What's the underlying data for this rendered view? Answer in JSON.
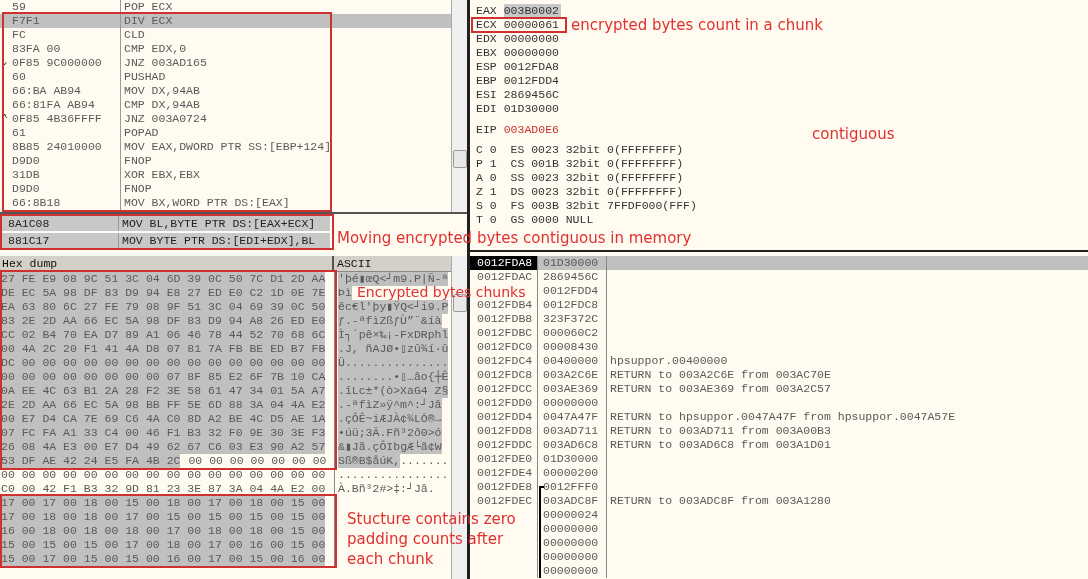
{
  "disassembly": {
    "rows": [
      {
        "hex": "59",
        "command": "POP ECX",
        "selected": false
      },
      {
        "hex": "F7F1",
        "command": "DIV ECX",
        "selected": true
      },
      {
        "hex": "FC",
        "command": "CLD",
        "selected": false
      },
      {
        "hex": "83FA 00",
        "command": "CMP EDX,0",
        "selected": false
      },
      {
        "hex": "0F85 9C000000",
        "command": "JNZ 003AD165",
        "selected": false,
        "marker": "⌄"
      },
      {
        "hex": "60",
        "command": "PUSHAD",
        "selected": false
      },
      {
        "hex": "66:BA AB94",
        "command": "MOV DX,94AB",
        "selected": false
      },
      {
        "hex": "66:81FA AB94",
        "command": "CMP DX,94AB",
        "selected": false
      },
      {
        "hex": "0F85 4B36FFFF",
        "command": "JNZ 003A0724",
        "selected": false,
        "marker": "^"
      },
      {
        "hex": "61",
        "command": "POPAD",
        "selected": false
      },
      {
        "hex": "8B85 24010000",
        "command": "MOV EAX,DWORD PTR SS:[EBP+124]",
        "selected": false
      },
      {
        "hex": "D9D0",
        "command": "FNOP",
        "selected": false
      },
      {
        "hex": "31DB",
        "command": "XOR EBX,EBX",
        "selected": false
      },
      {
        "hex": "D9D0",
        "command": "FNOP",
        "selected": false
      },
      {
        "hex": "66:8B18",
        "command": "MOV BX,WORD PTR DS:[EAX]",
        "selected": false
      }
    ],
    "pinned_rows": [
      {
        "hex": "8A1C08",
        "command": "MOV BL,BYTE PTR DS:[EAX+ECX]"
      },
      {
        "hex": "881C17",
        "command": "MOV BYTE PTR DS:[EDI+EDX],BL"
      }
    ]
  },
  "registers": {
    "rows": [
      {
        "name": "EAX",
        "value": "003B0002",
        "selected": true,
        "changed": false
      },
      {
        "name": "ECX",
        "value": "00000061",
        "selected": false,
        "changed": false
      },
      {
        "name": "EDX",
        "value": "00000000",
        "selected": false,
        "changed": false
      },
      {
        "name": "EBX",
        "value": "00000000",
        "selected": false,
        "changed": false
      },
      {
        "name": "ESP",
        "value": "0012FDA8",
        "selected": false,
        "changed": false
      },
      {
        "name": "EBP",
        "value": "0012FDD4",
        "selected": false,
        "changed": false
      },
      {
        "name": "ESI",
        "value": "2869456C",
        "selected": false,
        "changed": false
      },
      {
        "name": "EDI",
        "value": "01D30000",
        "selected": false,
        "changed": false
      }
    ],
    "eip": {
      "name": "EIP",
      "value": "003AD0E6",
      "selected": false,
      "changed": true
    },
    "flags": [
      "C 0  ES 0023 32bit 0(FFFFFFFF)",
      "P 1  CS 001B 32bit 0(FFFFFFFF)",
      "A 0  SS 0023 32bit 0(FFFFFFFF)",
      "Z 1  DS 0023 32bit 0(FFFFFFFF)",
      "S 0  FS 003B 32bit 7FFDF000(FFF)",
      "T 0  GS 0000 NULL"
    ]
  },
  "hex_dump": {
    "columns": [
      "Hex dump",
      "ASCII"
    ],
    "rows": [
      {
        "hex": [
          {
            "text": "27 FE E9 08 9C 51 3C 04 6D 39 0C 50 7C D1 2D AA",
            "selected": true
          }
        ],
        "ascii": [
          {
            "text": "'þé▮œQ<┘m9.P|Ñ-ª",
            "selected": true
          }
        ]
      },
      {
        "hex": [
          {
            "text": "DE EC 5A 98 DF 83 D9 94 E8 27 ED E0 C2 1D 0E 7E",
            "selected": true
          }
        ],
        "ascii": [
          {
            "text": "Þì",
            "selected": true
          }
        ]
      },
      {
        "hex": [
          {
            "text": "EA 63 80 6C 27 FE 79 08 9F 51 3C 04 69 39 0C 50",
            "selected": true
          }
        ],
        "ascii": [
          {
            "text": "êc€l'þy▮ŸQ<┘i9.P",
            "selected": true
          }
        ]
      },
      {
        "hex": [
          {
            "text": "83 2E 2D AA 66 EC 5A 98 DF 83 D9 94 A8 26 ED E0",
            "selected": true
          }
        ],
        "ascii": [
          {
            "text": "ƒ.-ªfìZßƒÙ”¨&íà",
            "selected": true
          }
        ]
      },
      {
        "hex": [
          {
            "text": "CC 02 B4 70 EA D7 89 A1 06 46 78 44 52 70 68 6C",
            "selected": true
          }
        ],
        "ascii": [
          {
            "text": "Ì┐´pê×‰¡-FxDRphl",
            "selected": true
          }
        ]
      },
      {
        "hex": [
          {
            "text": "00 4A 2C 20 F1 41 4A D8 07 81 7A FB BE ED B7 FB",
            "selected": true
          }
        ],
        "ascii": [
          {
            "text": ".J, ñAJØ•▯zû¾í·û",
            "selected": true
          }
        ]
      },
      {
        "hex": [
          {
            "text": "DC 00 00 00 00 00 00 00 00 00 00 00 00 00 00 00",
            "selected": true
          }
        ],
        "ascii": [
          {
            "text": "Ü...............",
            "selected": true
          }
        ]
      },
      {
        "hex": [
          {
            "text": "00 00 00 00 00 00 00 00 07 8F 85 E2 6F 7B 10 CA",
            "selected": true
          }
        ],
        "ascii": [
          {
            "text": "........•▯…âo{┼Ê",
            "selected": true
          }
        ]
      },
      {
        "hex": [
          {
            "text": "0A EE 4C 63 B1 2A 28 F2 3E 58 61 47 34 01 5A A7",
            "selected": true
          }
        ],
        "ascii": [
          {
            "text": ".îLc±*(ò>XaG4 Z§",
            "selected": true
          }
        ]
      },
      {
        "hex": [
          {
            "text": "2E 2D AA 66 EC 5A 98 BB FF 5E 6D 88 3A 04 4A E2",
            "selected": true
          }
        ],
        "ascii": [
          {
            "text": ".-ªfìZ»ÿ^m^:┘Jâ",
            "selected": true
          }
        ]
      },
      {
        "hex": [
          {
            "text": "00 E7 D4 CA 7E 69 C6 4A C0 8D A2 BE 4C D5 AE 1A",
            "selected": true
          }
        ],
        "ascii": [
          {
            "text": ".çÔÊ~iÆJÀ¢¾LÕ®→",
            "selected": true
          }
        ]
      },
      {
        "hex": [
          {
            "text": "07 FC FA A1 33 C4 00 46 F1 B3 32 F0 9E 30 3E F3",
            "selected": true
          }
        ],
        "ascii": [
          {
            "text": "•úü;3Ä.Fñ³2ð0>ó",
            "selected": true
          }
        ]
      },
      {
        "hex": [
          {
            "text": "26 08 4A E3 00 E7 D4 49 62 67 C6 03 E3 90 A2 57",
            "selected": true
          }
        ],
        "ascii": [
          {
            "text": "&▮Jã.çÔIbgÆ└ã¢W",
            "selected": true
          }
        ]
      },
      {
        "hex": [
          {
            "text": "53 DF AE 42 24 E5 FA 4B 2C",
            "selected": true
          },
          {
            "text": "00 00 00 00 00 00 00",
            "selected": false
          }
        ],
        "ascii": [
          {
            "text": "Sß®B$åúK,",
            "selected": true
          },
          {
            "text": ".......",
            "selected": false
          }
        ]
      },
      {
        "hex": [
          {
            "text": "00 00 00 00 00 00 00 00 00 00 00 00 00 00 00 00",
            "selected": false
          }
        ],
        "ascii": [
          {
            "text": "................",
            "selected": false
          }
        ]
      },
      {
        "hex": [
          {
            "text": "C0 00 42 F1 B3 32 9D 81 23 3E 87 3A 04 4A E2 00",
            "selected": false
          }
        ],
        "ascii": [
          {
            "text": "À.Bñ³2#>‡:┘Jâ.",
            "selected": false
          }
        ]
      },
      {
        "hex": [
          {
            "text": "17 00 17 00 18 00 15 00 18 00 17 00 18 00 15 00",
            "selected": true
          }
        ]
      },
      {
        "hex": [
          {
            "text": "17 00 18 00 18 00 17 00 15 00 15 00 15 00 15 00",
            "selected": true
          }
        ]
      },
      {
        "hex": [
          {
            "text": "16 00 18 00 18 00 18 00 17 00 18 00 18 00 15 00",
            "selected": true
          }
        ]
      },
      {
        "hex": [
          {
            "text": "15 00 15 00 15 00 17 00 18 00 17 00 16 00 15 00",
            "selected": true
          }
        ]
      },
      {
        "hex": [
          {
            "text": "15 00 17 00 15 00 15 00 16 00 17 00 15 00 16 00",
            "selected": true
          }
        ]
      }
    ]
  },
  "stack": {
    "rows": [
      {
        "address": "0012FDA8",
        "value": "01D30000",
        "selected": true,
        "kind": "plain"
      },
      {
        "address": "0012FDAC",
        "value": "2869456C",
        "selected": false,
        "kind": "plain"
      },
      {
        "value": "0012FDD4",
        "selected": false,
        "kind": "plain"
      },
      {
        "address": "0012FDB4",
        "value": "0012FDC8",
        "selected": false,
        "kind": "plain"
      },
      {
        "address": "0012FDB8",
        "value": "323F372C",
        "selected": false,
        "kind": "plain"
      },
      {
        "address": "0012FDBC",
        "value": "000060C2",
        "selected": false,
        "kind": "plain"
      },
      {
        "address": "0012FDC0",
        "value": "00008430",
        "selected": false,
        "kind": "plain"
      },
      {
        "address": "0012FDC4",
        "value": "00400000",
        "selected": false,
        "kind": "plain",
        "comment": "hpsuppor.00400000"
      },
      {
        "address": "0012FDC8",
        "value": "003A2C6E",
        "selected": false,
        "kind": "plain",
        "comment": "RETURN to 003A2C6E from 003AC70E"
      },
      {
        "address": "0012FDCC",
        "value": "003AE369",
        "selected": false,
        "kind": "plain",
        "comment": "RETURN to 003AE369 from 003A2C57"
      },
      {
        "address": "0012FDD0",
        "value": "00000000",
        "selected": false,
        "kind": "plain"
      },
      {
        "address": "0012FDD4",
        "value": "0047A47F",
        "selected": false,
        "kind": "plain",
        "comment": "RETURN to hpsuppor.0047A47F from hpsuppor.0047A57E"
      },
      {
        "address": "0012FDD8",
        "value": "003AD711",
        "selected": false,
        "kind": "plain",
        "comment": "RETURN to 003AD711 from 003A00B3"
      },
      {
        "address": "0012FDDC",
        "value": "003AD6C8",
        "selected": false,
        "kind": "plain",
        "comment": "RETURN to 003AD6C8 from 003A1D01"
      },
      {
        "address": "0012FDE0",
        "value": "01D30000",
        "selected": false,
        "kind": "plain"
      },
      {
        "address": "0012FDE4",
        "value": "00000200",
        "selected": false,
        "kind": "plain"
      },
      {
        "address": "0012FDE8",
        "value": "0012FFF0",
        "selected": false,
        "kind": "frame-start"
      },
      {
        "address": "0012FDEC",
        "value": "003ADC8F",
        "selected": false,
        "kind": "frame",
        "comment": "RETURN to 003ADC8F from 003A1280"
      },
      {
        "value": "00000024",
        "selected": false,
        "kind": "frame"
      },
      {
        "value": "00000000",
        "selected": false,
        "kind": "frame"
      },
      {
        "value": "00000000",
        "selected": false,
        "kind": "frame"
      },
      {
        "value": "00000000",
        "selected": false,
        "kind": "frame"
      },
      {
        "value": "00000000",
        "selected": false,
        "kind": "frame"
      }
    ]
  },
  "annotations": [
    "encrypted bytes count in a chunk",
    "contiguous",
    "Moving encrypted bytes contiguous in memory",
    "Encrypted bytes chunks",
    "Stucture contains zero padding counts after each chunk"
  ]
}
